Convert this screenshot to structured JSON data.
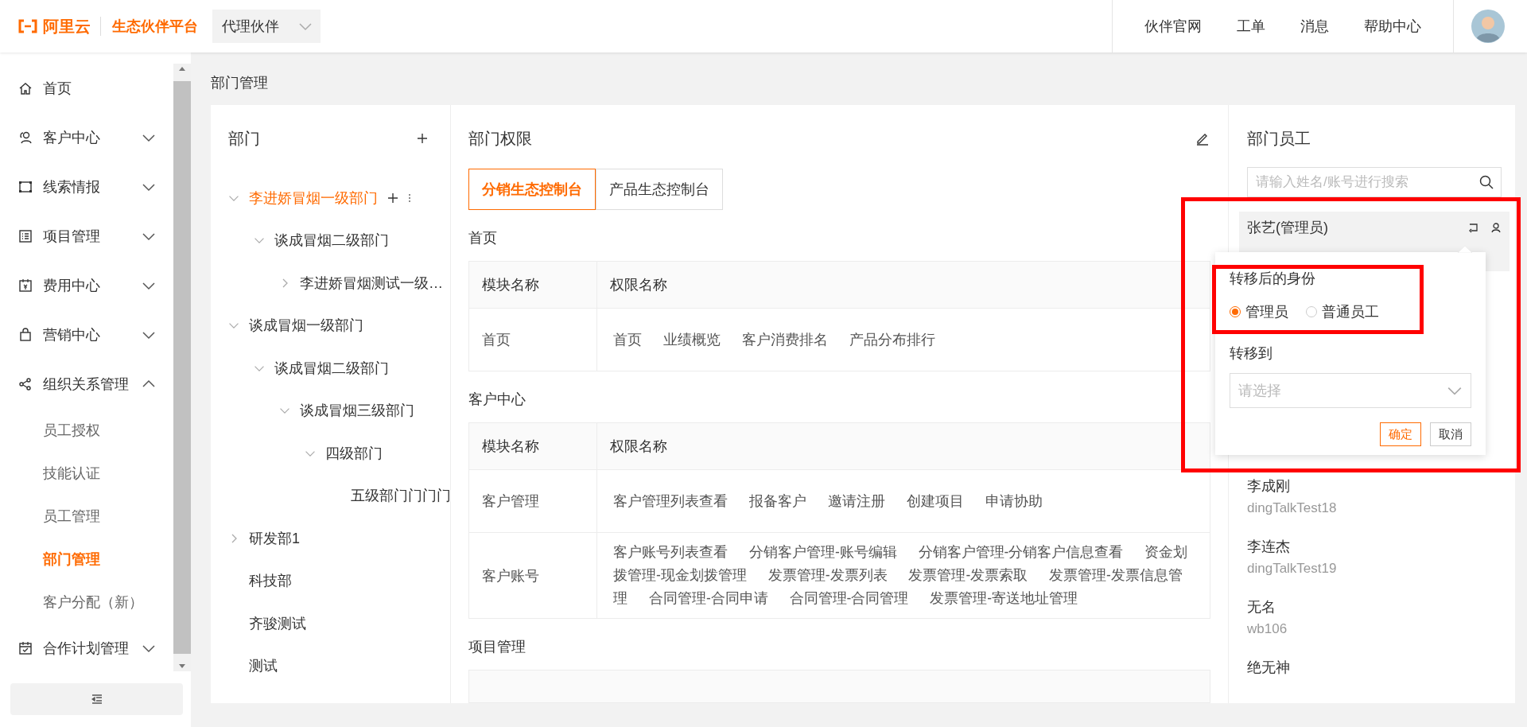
{
  "header": {
    "logo_text": "阿里云",
    "platform": "生态伙伴平台",
    "role_select": {
      "value": "代理伙伴"
    },
    "nav": [
      "伙伴官网",
      "工单",
      "消息",
      "帮助中心"
    ]
  },
  "sidebar": {
    "items": [
      {
        "label": "首页"
      },
      {
        "label": "客户中心",
        "expanded": false
      },
      {
        "label": "线索情报",
        "expanded": false
      },
      {
        "label": "项目管理",
        "expanded": false
      },
      {
        "label": "费用中心",
        "expanded": false
      },
      {
        "label": "营销中心",
        "expanded": false
      },
      {
        "label": "组织关系管理",
        "expanded": true,
        "children": [
          {
            "label": "员工授权",
            "selected": false
          },
          {
            "label": "技能认证",
            "selected": false
          },
          {
            "label": "员工管理",
            "selected": false
          },
          {
            "label": "部门管理",
            "selected": true
          },
          {
            "label": "客户分配（新）",
            "selected": false
          }
        ]
      },
      {
        "label": "合作计划管理",
        "expanded": false
      }
    ]
  },
  "breadcrumb": "部门管理",
  "departments": {
    "title": "部门",
    "tree": [
      {
        "label": "李进娇冒烟一级部门",
        "selected": true,
        "expanded": true,
        "children": [
          {
            "label": "谈成冒烟二级部门",
            "selected": false,
            "expanded": true,
            "children": [
              {
                "label": "李进娇冒烟测试一级…",
                "selected": false,
                "expanded": false
              }
            ]
          }
        ]
      },
      {
        "label": "谈成冒烟一级部门",
        "selected": false,
        "expanded": true,
        "children": [
          {
            "label": "谈成冒烟二级部门",
            "selected": false,
            "expanded": true,
            "children": [
              {
                "label": "谈成冒烟三级部门",
                "selected": false,
                "expanded": true,
                "children": [
                  {
                    "label": "四级部门",
                    "selected": false,
                    "expanded": true,
                    "children": [
                      {
                        "label": "五级部门门门门",
                        "selected": false
                      }
                    ]
                  }
                ]
              }
            ]
          }
        ]
      },
      {
        "label": "研发部1",
        "selected": false,
        "expanded": false
      },
      {
        "label": "科技部",
        "selected": false
      },
      {
        "label": "齐骏测试",
        "selected": false
      },
      {
        "label": "测试",
        "selected": false
      }
    ]
  },
  "permissions": {
    "title": "部门权限",
    "tabs": [
      {
        "label": "分销生态控制台",
        "selected": true
      },
      {
        "label": "产品生态控制台",
        "selected": false
      }
    ],
    "sections": [
      {
        "title": "首页",
        "columns": [
          "模块名称",
          "权限名称"
        ],
        "rows": [
          {
            "module": "首页",
            "items": [
              "首页",
              "业绩概览",
              "客户消费排名",
              "产品分布排行"
            ]
          }
        ]
      },
      {
        "title": "客户中心",
        "columns": [
          "模块名称",
          "权限名称"
        ],
        "rows": [
          {
            "module": "客户管理",
            "items": [
              "客户管理列表查看",
              "报备客户",
              "邀请注册",
              "创建项目",
              "申请协助"
            ]
          },
          {
            "module": "客户账号",
            "items": [
              "客户账号列表查看",
              "分销客户管理-账号编辑",
              "分销客户管理-分销客户信息查看",
              "资金划拨管理-现金划拨管理",
              "发票管理-发票列表",
              "发票管理-发票索取",
              "发票管理-发票信息管理",
              "合同管理-合同申请",
              "合同管理-合同管理",
              "发票管理-寄送地址管理"
            ]
          }
        ]
      },
      {
        "title": "项目管理"
      }
    ]
  },
  "employees": {
    "title": "部门员工",
    "search": {
      "placeholder": "请输入姓名/账号进行搜索"
    },
    "list": [
      {
        "name": "张艺(管理员)",
        "selected": true
      },
      {
        "name": "李成刚",
        "account": "dingTalkTest18",
        "selected": false
      },
      {
        "name": "李连杰",
        "account": "dingTalkTest19",
        "selected": false
      },
      {
        "name": "无名",
        "account": "wb106",
        "selected": false
      },
      {
        "name": "绝无神",
        "selected": false
      }
    ]
  },
  "transfer_popover": {
    "highlighted": true,
    "identity": {
      "label": "转移后的身份",
      "highlighted": true,
      "options": [
        {
          "label": "管理员",
          "selected": true
        },
        {
          "label": "普通员工",
          "selected": false
        }
      ]
    },
    "target": {
      "label": "转移到",
      "placeholder": "请选择"
    },
    "buttons": [
      {
        "label": "确定",
        "kind": "primary"
      },
      {
        "label": "取消",
        "kind": "default"
      }
    ]
  }
}
